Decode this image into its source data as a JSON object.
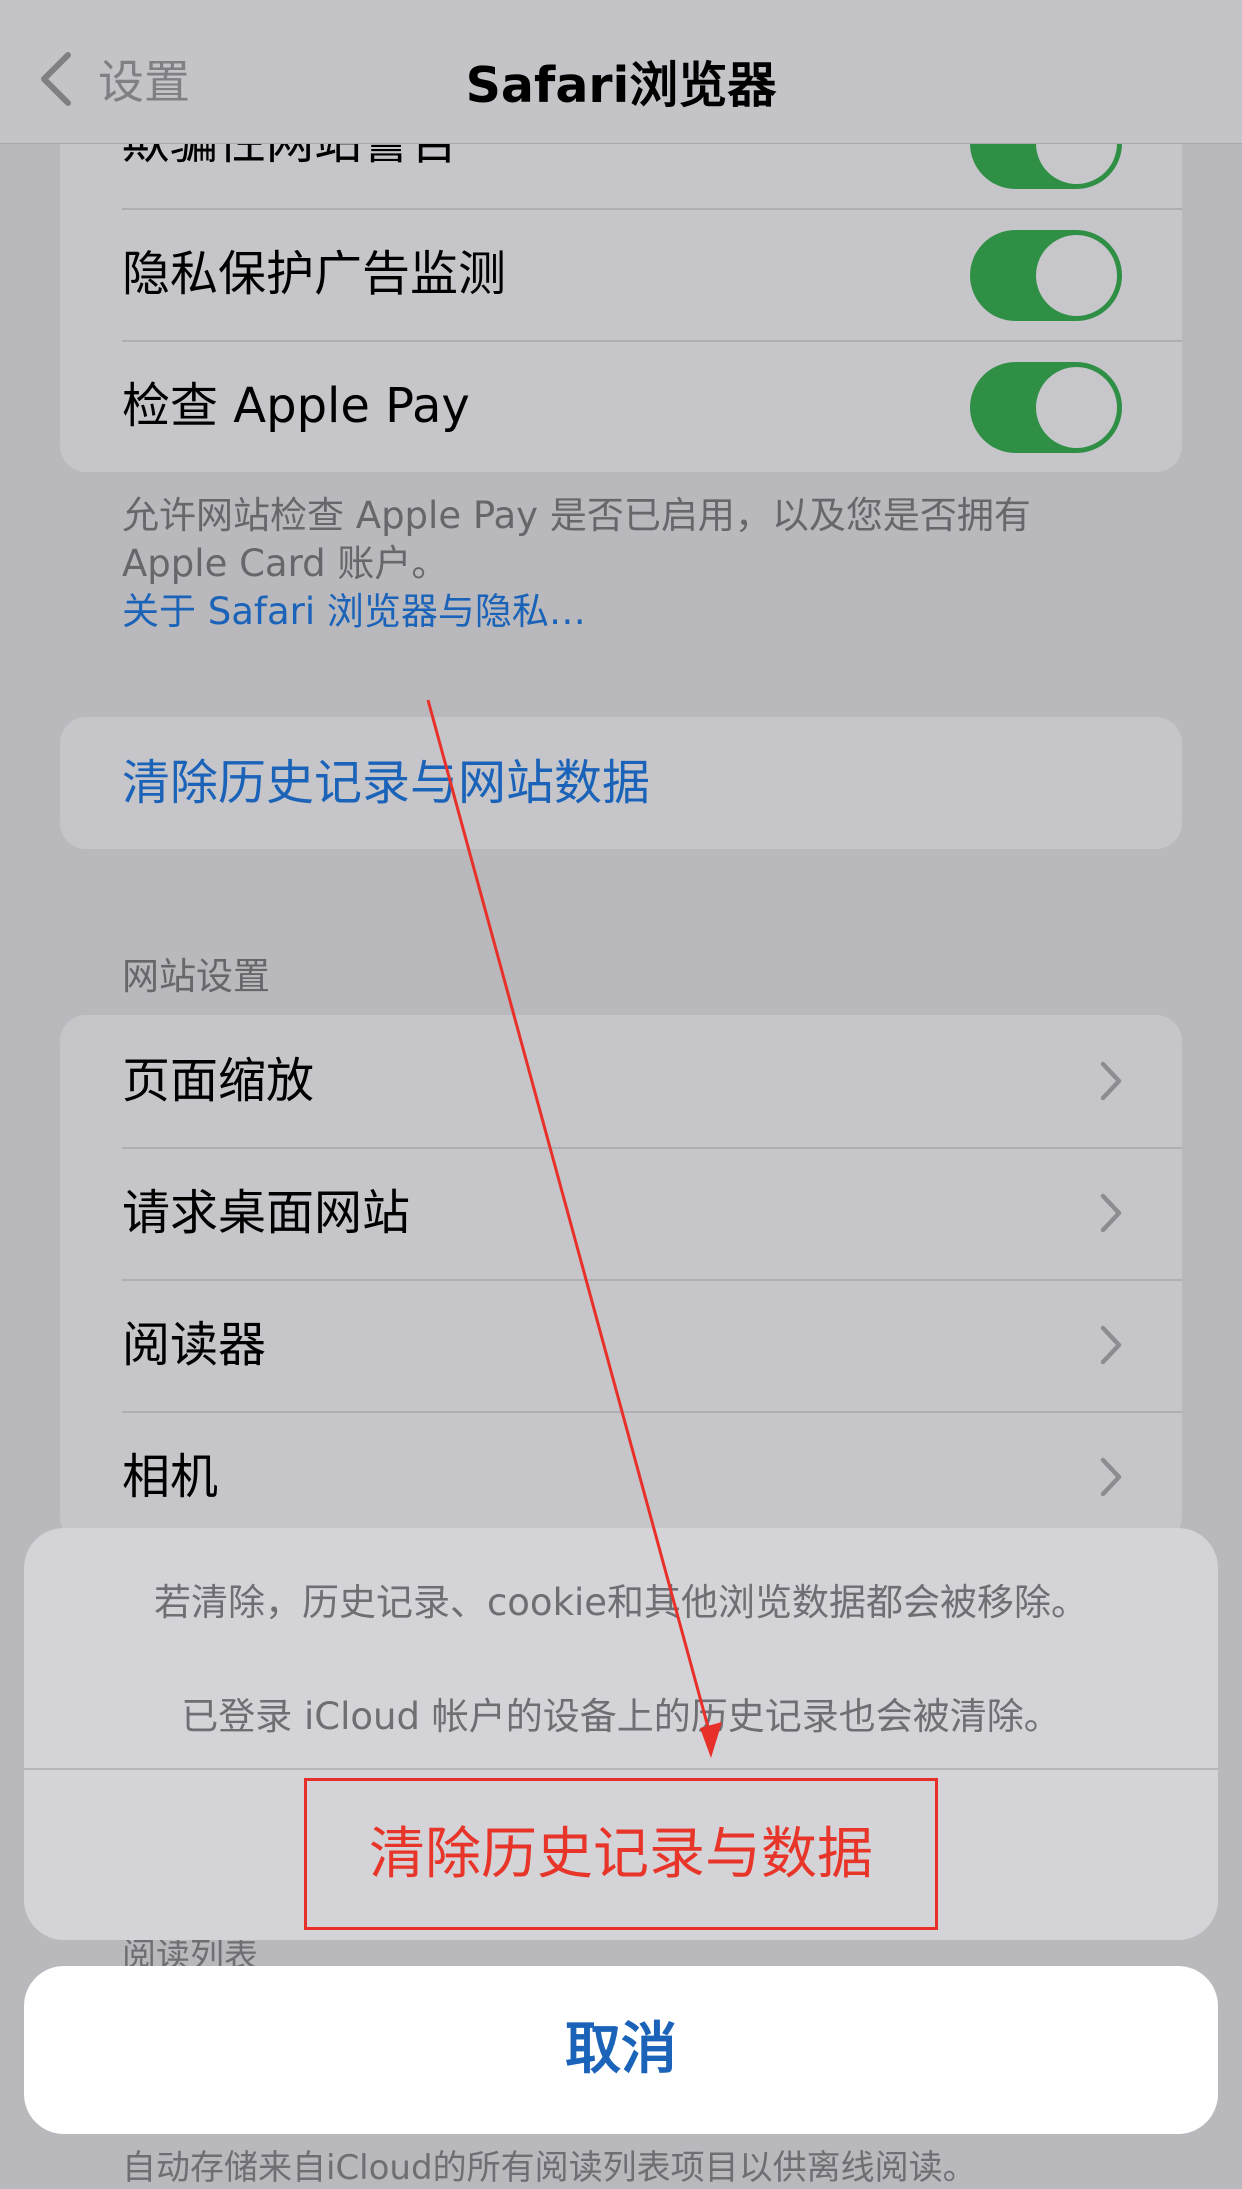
{
  "nav": {
    "back_label": "设置",
    "title": "Safari浏览器"
  },
  "privacy_group": {
    "rows": [
      {
        "label": "欺骗性网站警告",
        "toggle_on": true
      },
      {
        "label": "隐私保护广告监测",
        "toggle_on": true
      },
      {
        "label": "检查 Apple Pay",
        "toggle_on": true
      }
    ],
    "footer_line1": "允许网站检查 Apple Pay 是否已启用，以及您是否拥有",
    "footer_line2": "Apple Card 账户。",
    "footer_link": "关于 Safari 浏览器与隐私…"
  },
  "clear_history_row": {
    "label": "清除历史记录与网站数据"
  },
  "website_settings": {
    "header": "网站设置",
    "rows": [
      {
        "label": "页面缩放"
      },
      {
        "label": "请求桌面网站"
      },
      {
        "label": "阅读器"
      },
      {
        "label": "相机"
      }
    ]
  },
  "action_sheet": {
    "message_line1": "若清除，历史记录、cookie和其他浏览数据都会被移除。",
    "message_line2": "已登录 iCloud 帐户的设备上的历史记录也会被清除。",
    "destructive_action": "清除历史记录与数据",
    "cancel": "取消"
  },
  "background_peek": {
    "reading_list_header": "阅读列表",
    "bottom_text": "自动存储来自iCloud的所有阅读列表项目以供离线阅读。"
  },
  "colors": {
    "accent": "#1a63b8",
    "destructive": "#e8352a",
    "toggle_on": "#2e8f45",
    "annotation": "#e8302a"
  },
  "icons": {
    "back": "chevron-left-icon",
    "row_disclosure": "chevron-right-icon"
  }
}
